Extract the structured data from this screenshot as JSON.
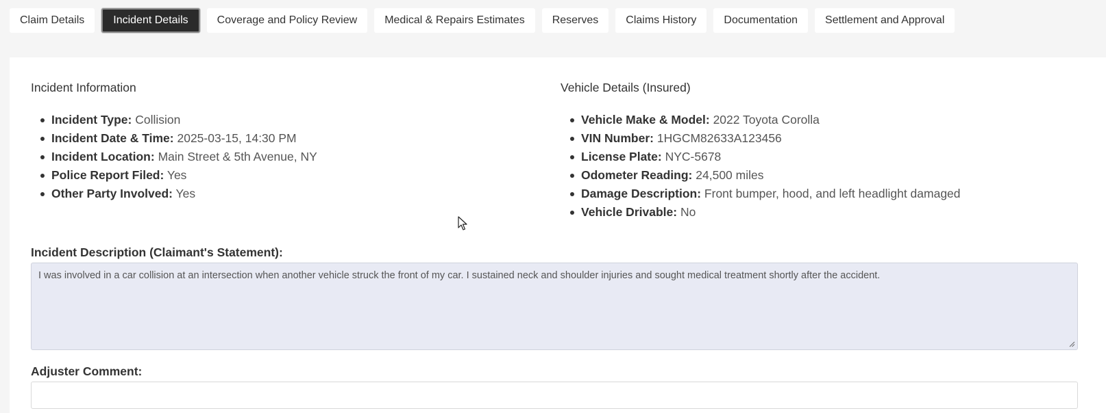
{
  "tabs": [
    {
      "label": "Claim Details",
      "active": false
    },
    {
      "label": "Incident Details",
      "active": true
    },
    {
      "label": "Coverage and Policy Review",
      "active": false
    },
    {
      "label": "Medical & Repairs Estimates",
      "active": false
    },
    {
      "label": "Reserves",
      "active": false
    },
    {
      "label": "Claims History",
      "active": false
    },
    {
      "label": "Documentation",
      "active": false
    },
    {
      "label": "Settlement and Approval",
      "active": false
    }
  ],
  "incident_info": {
    "title": "Incident Information",
    "items": [
      {
        "label": "Incident Type:",
        "value": "Collision"
      },
      {
        "label": "Incident Date & Time:",
        "value": "2025-03-15, 14:30 PM"
      },
      {
        "label": "Incident Location:",
        "value": "Main Street & 5th Avenue, NY"
      },
      {
        "label": "Police Report Filed:",
        "value": "Yes"
      },
      {
        "label": "Other Party Involved:",
        "value": "Yes"
      }
    ]
  },
  "vehicle_details": {
    "title": "Vehicle Details (Insured)",
    "items": [
      {
        "label": "Vehicle Make & Model:",
        "value": "2022 Toyota Corolla"
      },
      {
        "label": "VIN Number:",
        "value": "1HGCM82633A123456"
      },
      {
        "label": "License Plate:",
        "value": "NYC-5678"
      },
      {
        "label": "Odometer Reading:",
        "value": "24,500 miles"
      },
      {
        "label": "Damage Description:",
        "value": "Front bumper, hood, and left headlight damaged"
      },
      {
        "label": "Vehicle Drivable:",
        "value": "No"
      }
    ]
  },
  "incident_description": {
    "label": "Incident Description (Claimant's Statement):",
    "value": "I was involved in a car collision at an intersection when another vehicle struck the front of my car. I sustained neck and shoulder injuries and sought medical treatment shortly after the accident."
  },
  "adjuster_comment": {
    "label": "Adjuster Comment:",
    "value": ""
  },
  "icons": {
    "cursor": "mouse-pointer-icon",
    "resize": "resize-handle-icon"
  },
  "colors": {
    "active_tab_bg": "#2b2b2b",
    "description_bg": "#e8eaf4"
  }
}
